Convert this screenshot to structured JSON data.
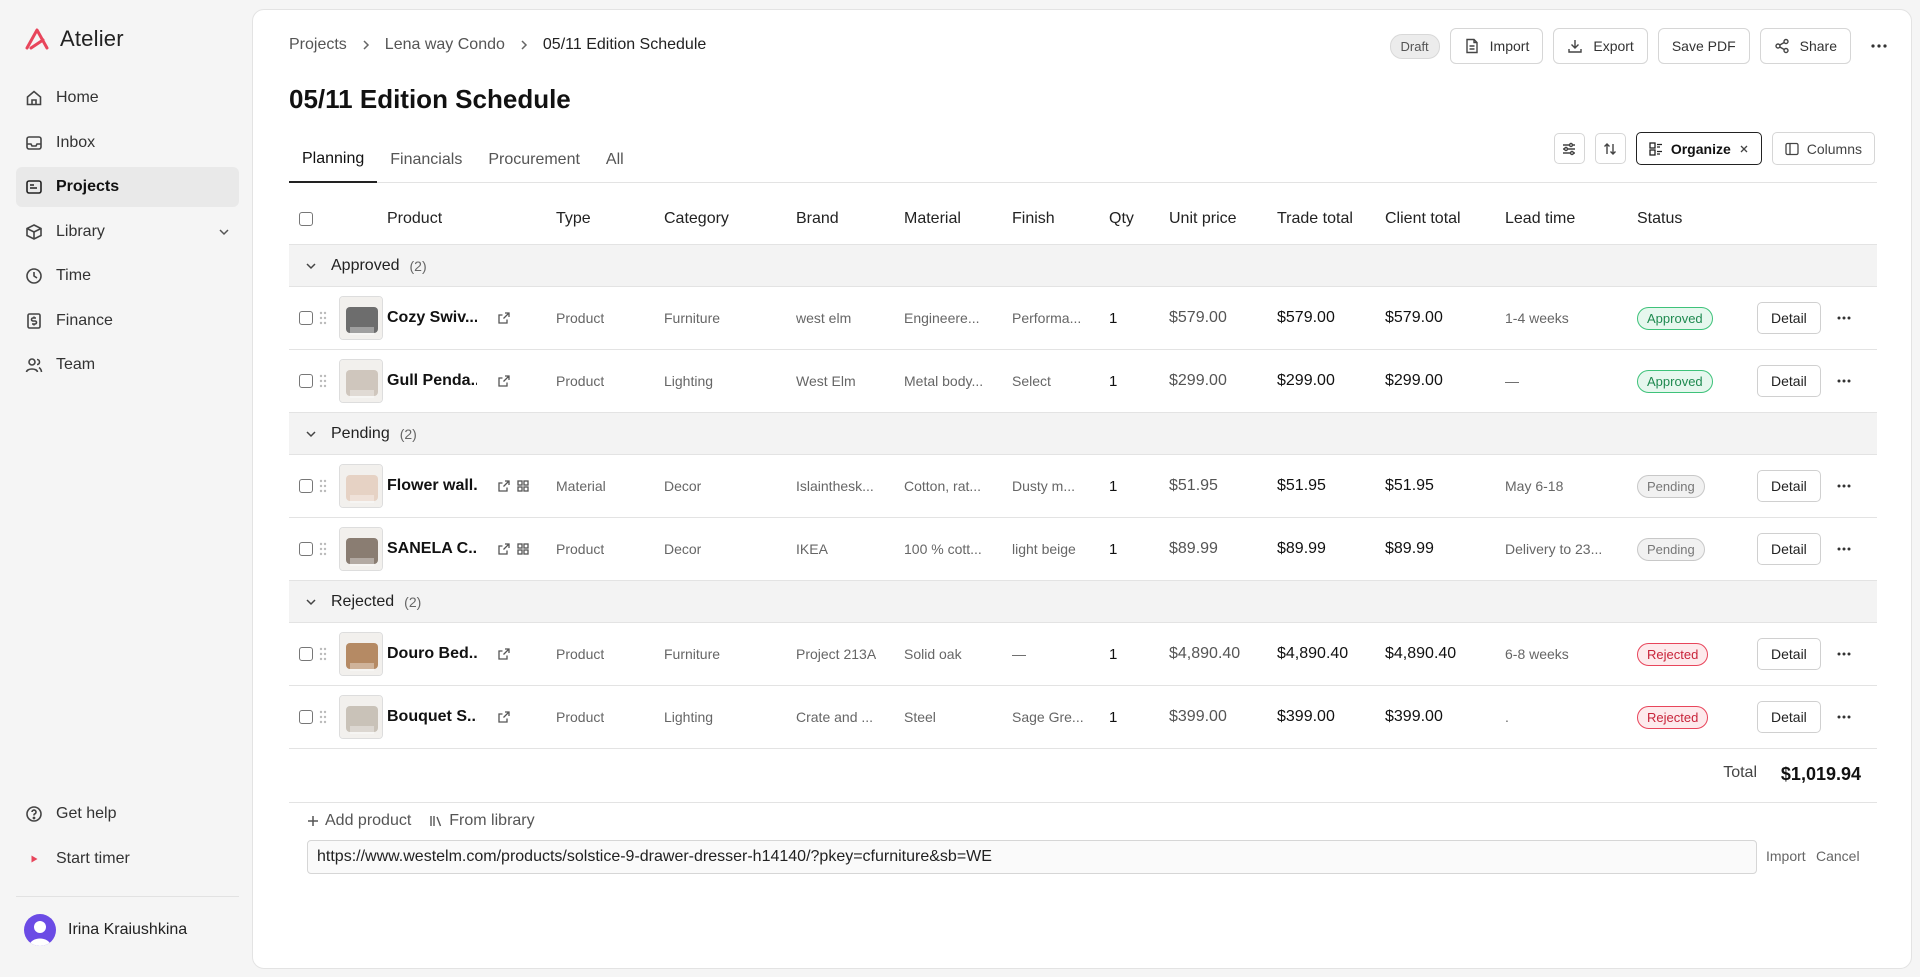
{
  "app": {
    "name": "Atelier",
    "accent": "#e8455b"
  },
  "sidebar": {
    "items": [
      {
        "label": "Home",
        "icon": "home-icon"
      },
      {
        "label": "Inbox",
        "icon": "inbox-icon"
      },
      {
        "label": "Projects",
        "icon": "projects-icon",
        "active": true
      },
      {
        "label": "Library",
        "icon": "library-icon"
      },
      {
        "label": "Time",
        "icon": "clock-icon"
      },
      {
        "label": "Finance",
        "icon": "finance-icon"
      },
      {
        "label": "Team",
        "icon": "team-icon"
      }
    ],
    "help_label": "Get help",
    "timer_label": "Start timer",
    "user_name": "Irina Kraiushkina"
  },
  "breadcrumb": [
    "Projects",
    "Lena way Condo",
    "05/11 Edition Schedule"
  ],
  "page_title": "05/11 Edition Schedule",
  "header_actions": {
    "draft": "Draft",
    "import": "Import",
    "export": "Export",
    "save_pdf": "Save PDF",
    "share": "Share"
  },
  "tabs": [
    "Planning",
    "Financials",
    "Procurement",
    "All"
  ],
  "toolbar": {
    "organize": "Organize",
    "columns": "Columns"
  },
  "columns": [
    "Product",
    "Type",
    "Category",
    "Brand",
    "Material",
    "Finish",
    "Qty",
    "Unit price",
    "Trade total",
    "Client total",
    "Lead time",
    "Status"
  ],
  "groups": [
    {
      "name": "Approved",
      "count": "(2)",
      "items": [
        {
          "product": "Cozy Swiv...",
          "type": "Product",
          "category": "Furniture",
          "brand": "west elm",
          "material": "Engineere...",
          "finish": "Performa...",
          "qty": "1",
          "unit_price": "$579.00",
          "trade_total": "$579.00",
          "client_total": "$579.00",
          "lead_time": "1-4 weeks",
          "status": "Approved",
          "detail": "Detail",
          "grid_icon": false
        },
        {
          "product": "Gull Penda...",
          "type": "Product",
          "category": "Lighting",
          "brand": "West Elm",
          "material": "Metal body...",
          "finish": "Select",
          "qty": "1",
          "unit_price": "$299.00",
          "trade_total": "$299.00",
          "client_total": "$299.00",
          "lead_time": "—",
          "status": "Approved",
          "detail": "Detail",
          "grid_icon": false
        }
      ]
    },
    {
      "name": "Pending",
      "count": "(2)",
      "items": [
        {
          "product": "Flower wall...",
          "type": "Material",
          "category": "Decor",
          "brand": "Islainthesk...",
          "material": "Cotton, rat...",
          "finish": "Dusty m...",
          "qty": "1",
          "unit_price": "$51.95",
          "trade_total": "$51.95",
          "client_total": "$51.95",
          "lead_time": "May 6-18",
          "status": "Pending",
          "detail": "Detail",
          "grid_icon": true
        },
        {
          "product": "SANELA C...",
          "type": "Product",
          "category": "Decor",
          "brand": "IKEA",
          "material": "100 % cott...",
          "finish": "light beige",
          "qty": "1",
          "unit_price": "$89.99",
          "trade_total": "$89.99",
          "client_total": "$89.99",
          "lead_time": "Delivery to 23...",
          "status": "Pending",
          "detail": "Detail",
          "grid_icon": true
        }
      ]
    },
    {
      "name": "Rejected",
      "count": "(2)",
      "items": [
        {
          "product": "Douro Bed...",
          "type": "Product",
          "category": "Furniture",
          "brand": "Project 213A",
          "material": "Solid oak",
          "finish": "—",
          "qty": "1",
          "unit_price": "$4,890.40",
          "trade_total": "$4,890.40",
          "client_total": "$4,890.40",
          "lead_time": "6-8 weeks",
          "status": "Rejected",
          "detail": "Detail",
          "grid_icon": false
        },
        {
          "product": "Bouquet S...",
          "type": "Product",
          "category": "Lighting",
          "brand": "Crate and ...",
          "material": "Steel",
          "finish": "Sage Gre...",
          "qty": "1",
          "unit_price": "$399.00",
          "trade_total": "$399.00",
          "client_total": "$399.00",
          "lead_time": ".",
          "status": "Rejected",
          "detail": "Detail",
          "grid_icon": false
        }
      ]
    }
  ],
  "status_colors": {
    "Approved": {
      "bg": "#e6f7ee",
      "border": "#3ec27a",
      "text": "#1f8a50"
    },
    "Pending": {
      "bg": "#f1f1f1",
      "border": "#c8c8c8",
      "text": "#777777"
    },
    "Rejected": {
      "bg": "#fdeaec",
      "border": "#e8455b",
      "text": "#c8243a"
    }
  },
  "total": {
    "label": "Total",
    "value": "$1,019.94"
  },
  "add": {
    "add_product": "Add product",
    "from_library": "From library"
  },
  "url_input": {
    "value": "https://www.westelm.com/products/solstice-9-drawer-dresser-h14140/?pkey=cfurniture&sb=WE",
    "import": "Import",
    "cancel": "Cancel"
  }
}
